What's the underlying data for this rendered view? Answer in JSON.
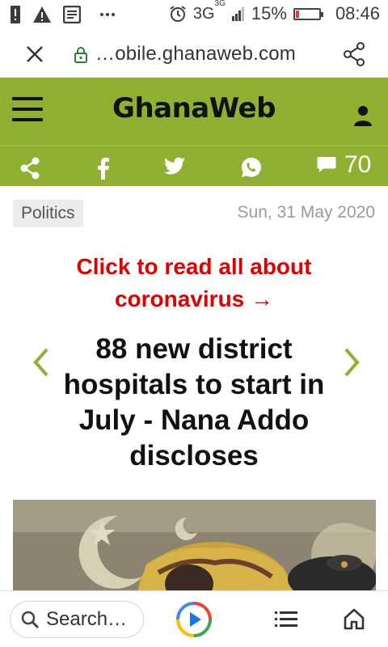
{
  "status_bar": {
    "network": "3G",
    "network_sup": "3G",
    "battery": "15%",
    "battery_level": 0.15,
    "time": "08:46"
  },
  "url_bar": {
    "url": "…obile.ghanaweb.com"
  },
  "header": {
    "logo": "GhanaWeb"
  },
  "social": {
    "comment_count": "70"
  },
  "article": {
    "category": "Politics",
    "date": "Sun, 31 May 2020",
    "corona_line1": "Click to read all about",
    "corona_line2": "coronavirus →",
    "headline": "88 new district hospitals to start in July - Nana Addo discloses"
  },
  "bottom_bar": {
    "search_placeholder": "Search…"
  },
  "colors": {
    "header_green": "#8fb031",
    "link_red": "#e00000",
    "chevron_green": "#8fb031"
  }
}
